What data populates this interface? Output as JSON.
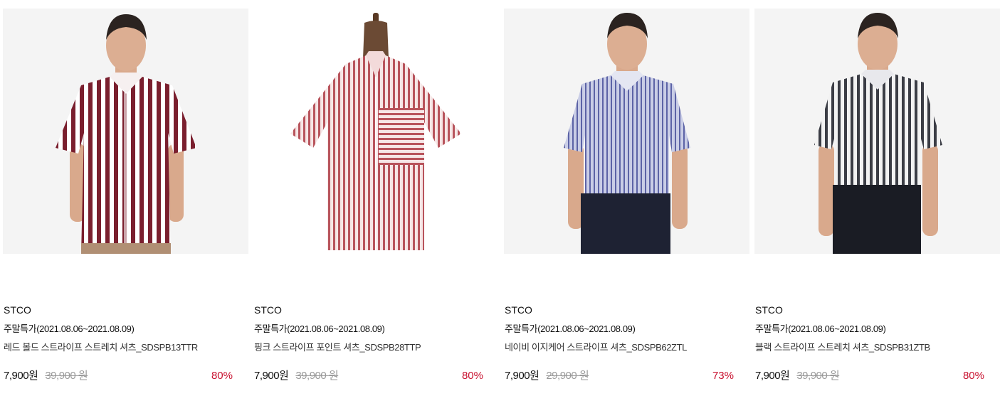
{
  "products": [
    {
      "brand": "STCO",
      "event": "주말특가(2021.08.06~2021.08.09)",
      "name": "레드 볼드 스트라이프 스트레치 셔츠_SDSPB13TTR",
      "sale_price": "7,900원",
      "original_price": "39,900 원",
      "discount": "80%",
      "image": "model-red-bold-stripe-shirt"
    },
    {
      "brand": "STCO",
      "event": "주말특가(2021.08.06~2021.08.09)",
      "name": "핑크 스트라이프 포인트 셔츠_SDSPB28TTP",
      "sale_price": "7,900원",
      "original_price": "39,900 원",
      "discount": "80%",
      "image": "mannequin-pink-stripe-shirt"
    },
    {
      "brand": "STCO",
      "event": "주말특가(2021.08.06~2021.08.09)",
      "name": "네이비 이지케어 스트라이프 셔츠_SDSPB62ZTL",
      "sale_price": "7,900원",
      "original_price": "29,900 원",
      "discount": "73%",
      "image": "model-navy-stripe-shirt"
    },
    {
      "brand": "STCO",
      "event": "주말특가(2021.08.06~2021.08.09)",
      "name": "블랙 스트라이프 스트레치 셔츠_SDSPB31ZTB",
      "sale_price": "7,900원",
      "original_price": "39,900 원",
      "discount": "80%",
      "image": "model-black-stripe-shirt"
    }
  ],
  "colors": {
    "discount": "#c8102e",
    "original_price": "#999999",
    "thumb_bg": "#f4f4f4"
  }
}
